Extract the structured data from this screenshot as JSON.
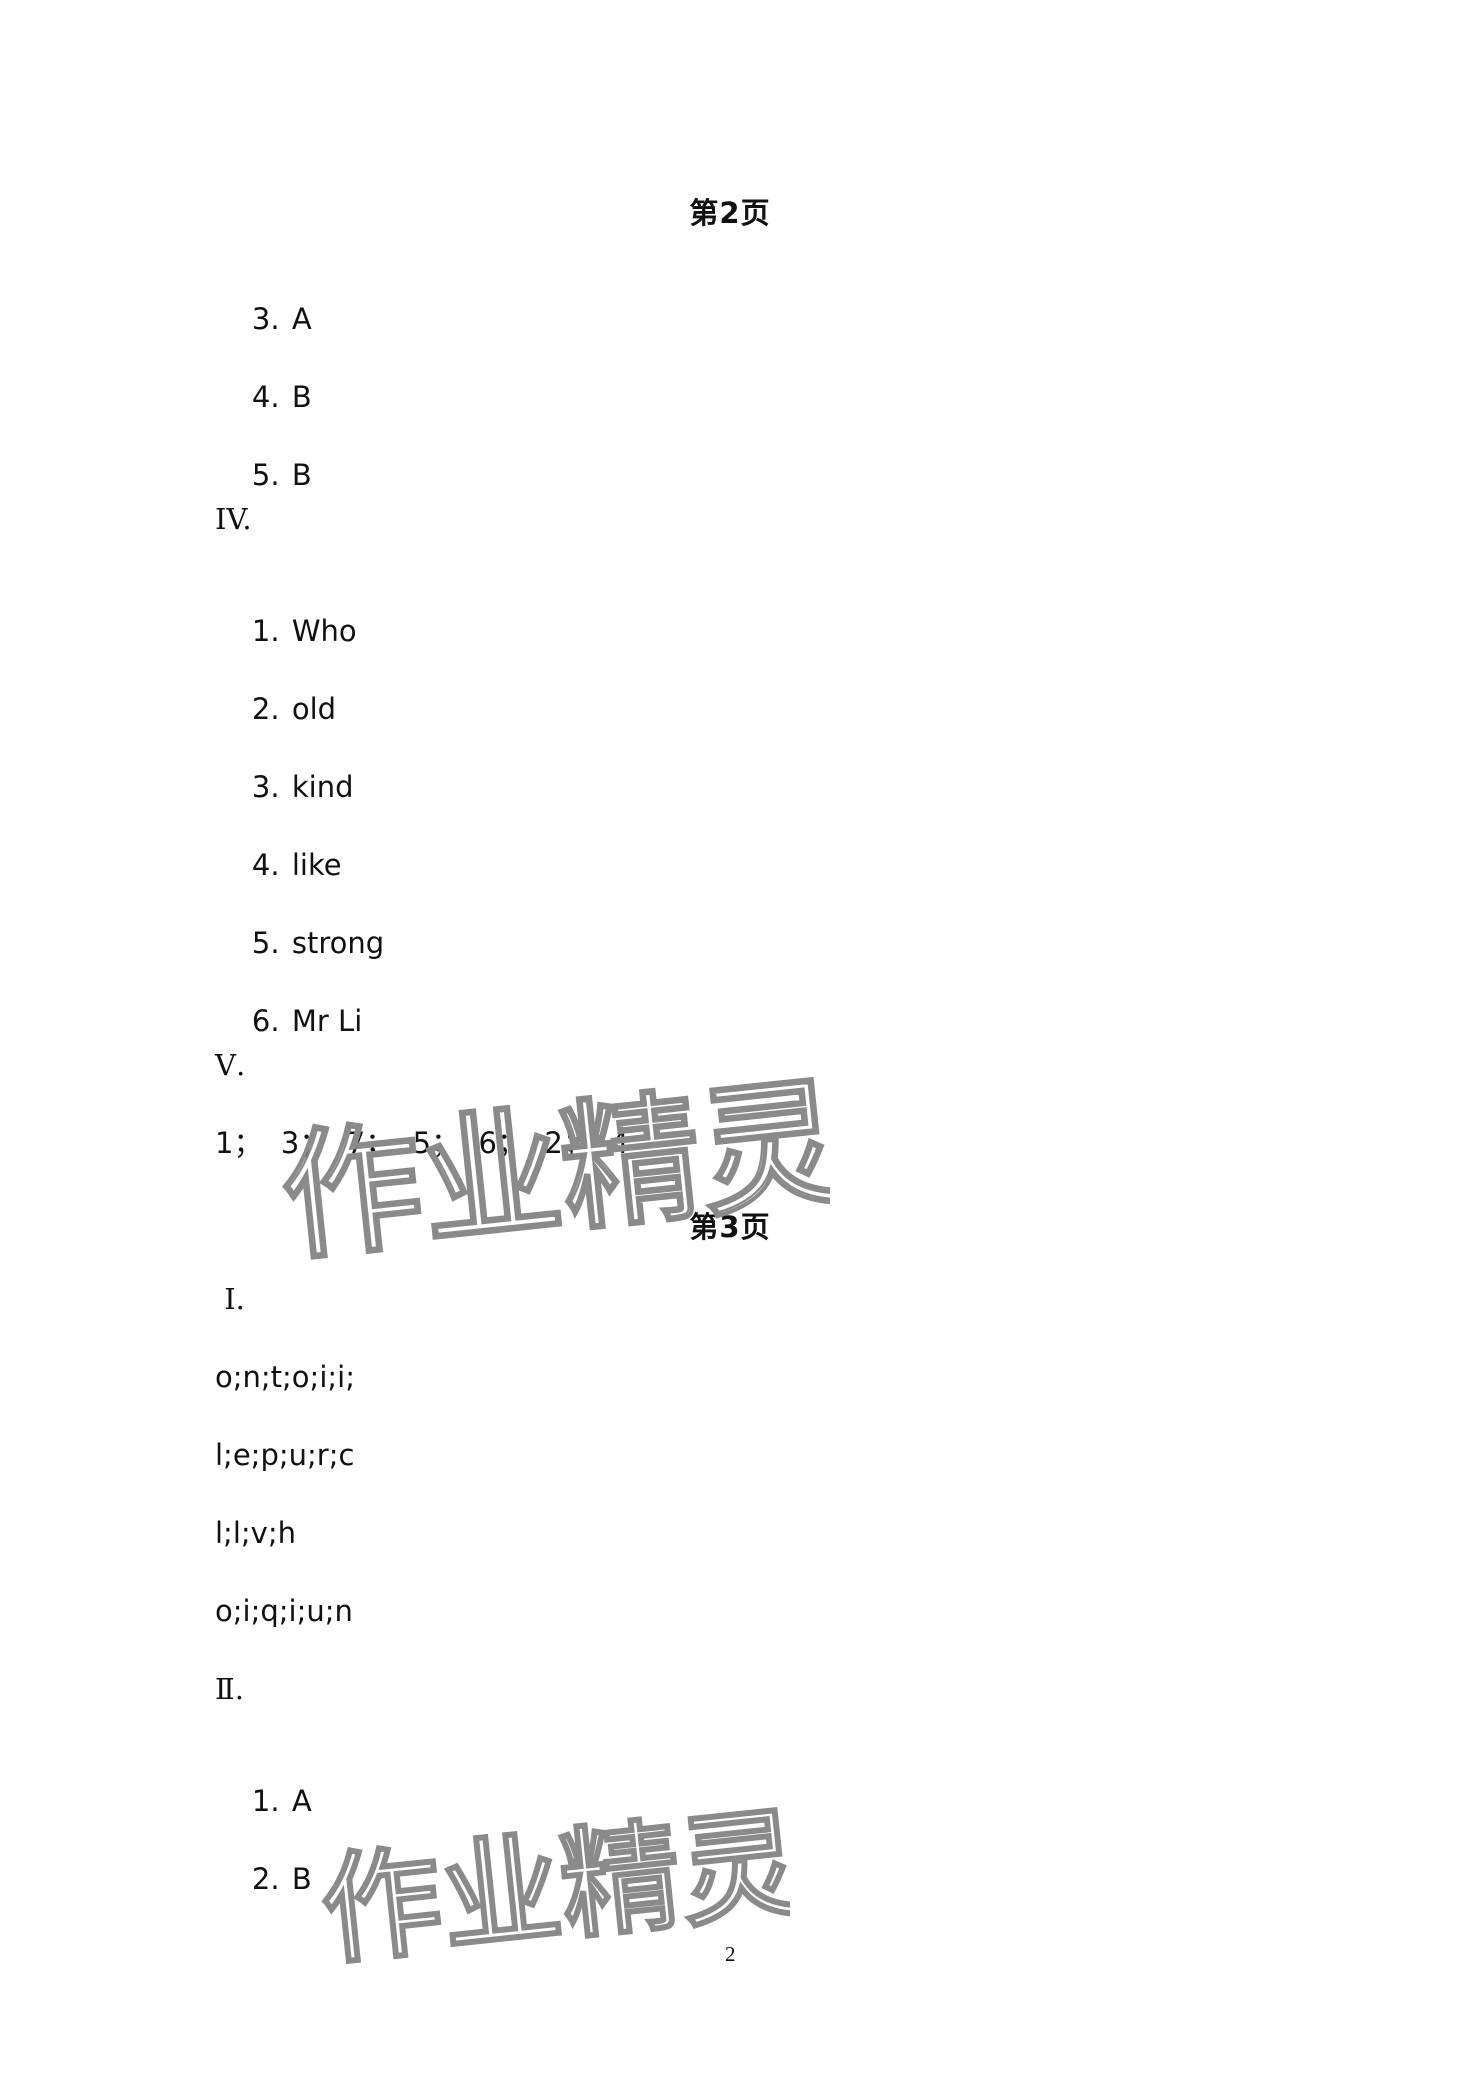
{
  "document": {
    "sections": [
      {
        "heading": "第2页",
        "lines": [
          {
            "num": "3.",
            "text": "A"
          },
          {
            "num": "4.",
            "text": "B"
          },
          {
            "num": "5.",
            "text": "B"
          },
          {
            "roman": "IV."
          },
          {
            "num": "1.",
            "text": "Who"
          },
          {
            "num": "2.",
            "text": "old"
          },
          {
            "num": "3.",
            "text": "kind"
          },
          {
            "num": "4.",
            "text": "like"
          },
          {
            "num": "5.",
            "text": "strong"
          },
          {
            "num": "6.",
            "text": "Mr Li"
          },
          {
            "roman": "Ⅴ."
          },
          {
            "plain": "1；  3；  7；  5；  6；  2；  4"
          }
        ]
      },
      {
        "heading": "第3页",
        "lines": [
          {
            "roman": " Ⅰ."
          },
          {
            "plain": "o;n;t;o;i;i;"
          },
          {
            "plain": "l;e;p;u;r;c"
          },
          {
            "plain": "l;l;v;h"
          },
          {
            "plain": "o;i;q;i;u;n"
          },
          {
            "roman": "Ⅱ."
          },
          {
            "num": "1.",
            "text": "A"
          },
          {
            "num": "2.",
            "text": "B"
          }
        ]
      }
    ],
    "page_number": "2",
    "watermark_text": "作业精灵"
  }
}
